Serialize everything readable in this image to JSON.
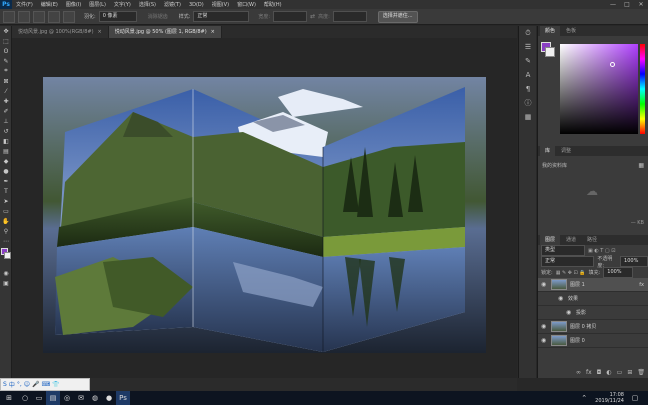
{
  "menubar": {
    "logo": "Ps",
    "items": [
      "文件(F)",
      "编辑(E)",
      "图像(I)",
      "图层(L)",
      "文字(Y)",
      "选择(S)",
      "滤镜(T)",
      "3D(D)",
      "视图(V)",
      "窗口(W)",
      "帮助(H)"
    ],
    "window_controls": [
      "—",
      "□",
      "✕"
    ]
  },
  "options": {
    "feather_label": "羽化:",
    "feather_value": "0 像素",
    "antialias_label": "消除锯齿",
    "style_label": "样式:",
    "style_value": "正常",
    "width_label": "宽度:",
    "height_label": "高度:",
    "select_mask_button": "选择并遮住..."
  },
  "tabs": [
    {
      "label": "悦动风景.jpg @ 100%(RGB/8#)",
      "active": false
    },
    {
      "label": "悦动风景.jpg @ 50% (图层 1, RGB/8#)",
      "active": true
    }
  ],
  "panels": {
    "color_tabs": [
      "颜色",
      "色板"
    ],
    "adjust_tabs": [
      "库",
      "调整"
    ],
    "library_placeholder": "我的资料库",
    "library_size": "— KB",
    "layer_tabs": [
      "图层",
      "通道",
      "路径"
    ],
    "filter_kind": "类型",
    "blend_mode": "正常",
    "opacity_label": "不透明度:",
    "opacity_value": "100%",
    "lock_label": "锁定:",
    "fill_label": "填充:",
    "fill_value": "100%",
    "layers": [
      {
        "name": "图层 1",
        "selected": true,
        "fx": "fx"
      },
      {
        "name": "效果",
        "selected": false,
        "fx": ""
      },
      {
        "name": "投影",
        "selected": false,
        "fx": ""
      },
      {
        "name": "图层 0 拷贝",
        "selected": false,
        "fx": ""
      },
      {
        "name": "图层 0",
        "selected": false,
        "fx": ""
      }
    ]
  },
  "colors": {
    "foreground": "#8a3fc4",
    "background": "#f0f0f0",
    "ps_blue": "#31a8ff"
  },
  "taskbar": {
    "time": "17:08",
    "date": "2019/11/24",
    "apps": [
      "windows-icon",
      "file-explorer-icon",
      "chrome-icon",
      "mail-icon",
      "wechat-icon",
      "photoshop-icon"
    ]
  }
}
